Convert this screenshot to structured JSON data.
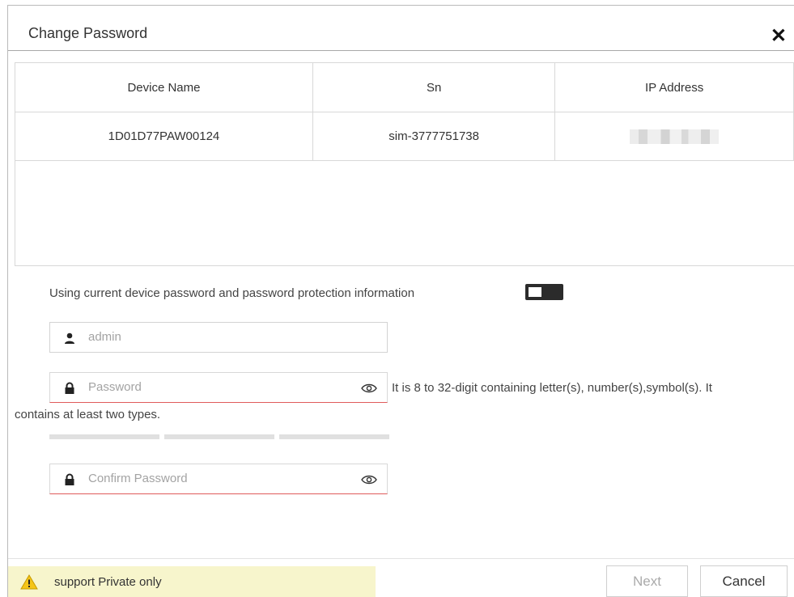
{
  "dialog": {
    "title": "Change Password"
  },
  "table": {
    "headers": [
      "Device Name",
      "Sn",
      "IP Address"
    ],
    "rows": [
      {
        "device_name": "1D01D77PAW00124",
        "sn": "sim-3777751738"
      }
    ]
  },
  "form": {
    "toggle_label": "Using current device password and password protection information",
    "username_placeholder": "admin",
    "password_placeholder": "Password",
    "password_hint_line1": "It is 8 to 32-digit containing letter(s), number(s),symbol(s). It",
    "password_hint_line2": "contains at least two types.",
    "confirm_placeholder": "Confirm Password"
  },
  "footer": {
    "warning": "support Private only",
    "next_label": "Next",
    "cancel_label": "Cancel"
  },
  "icons": {
    "close": "close-icon",
    "user": "user-icon",
    "lock": "lock-icon",
    "eye": "eye-icon",
    "warning": "warning-icon"
  },
  "colors": {
    "error_underline": "#e05b5b",
    "warning_bg": "#f7f5cc",
    "toggle_bg": "#2b2b2b"
  }
}
